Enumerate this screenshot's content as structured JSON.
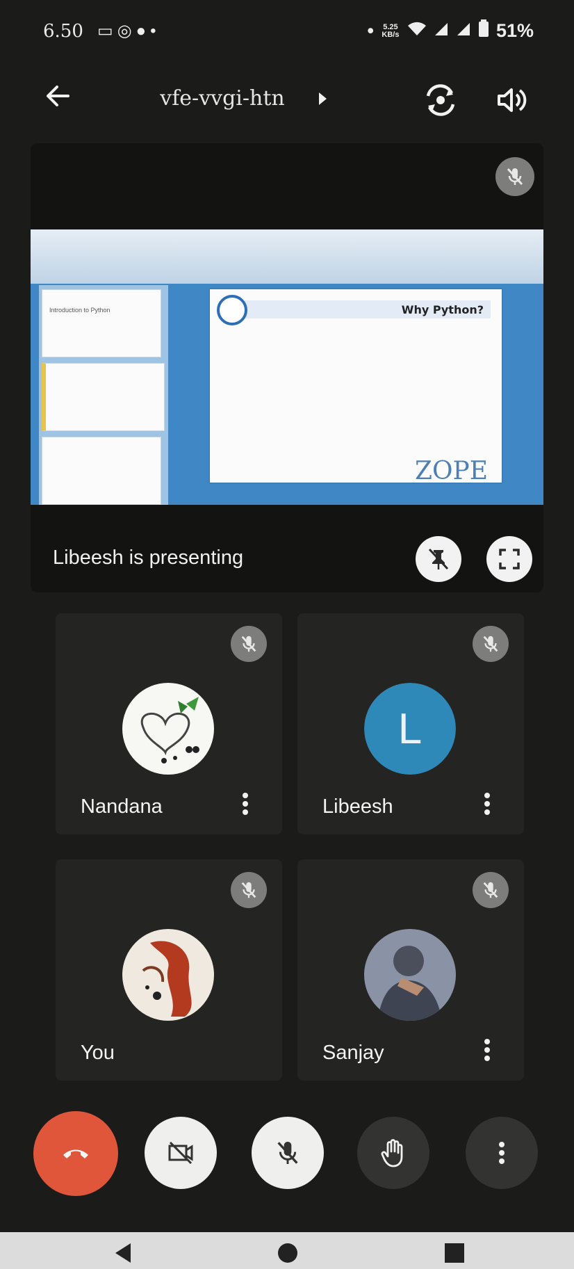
{
  "status_bar": {
    "time": "6.50",
    "left_icons": [
      "camera-notification-icon",
      "whatsapp-icon",
      "chat-icon",
      "dot-icon"
    ],
    "net_speed": "5.25 KB/s",
    "right_icons": [
      "dot-icon",
      "wifi-icon",
      "signal-icon",
      "signal-icon",
      "battery-icon"
    ],
    "battery": "51%"
  },
  "top_bar": {
    "meeting_code": "vfe-vvgi-htn",
    "icons": [
      "back-arrow-icon",
      "chevron-right-icon",
      "switch-camera-icon",
      "speaker-icon"
    ]
  },
  "presentation": {
    "label": "Libeesh is presenting",
    "slide_title": "Why Python?",
    "slide_brand": "ZOPE",
    "thumb_text": "Introduction to Python"
  },
  "participants": [
    {
      "name": "Nandana",
      "avatar": "photo",
      "muted": true
    },
    {
      "name": "Libeesh",
      "avatar_letter": "L",
      "avatar_color": "#2f89b8",
      "muted": true
    },
    {
      "name": "You",
      "avatar": "photo",
      "muted": true
    },
    {
      "name": "Sanjay",
      "avatar": "photo",
      "muted": true
    }
  ],
  "controls": [
    "end-call",
    "camera-off",
    "mic-off",
    "raise-hand",
    "more-options"
  ],
  "colors": {
    "background": "#1b1b19",
    "tile": "#242422",
    "end_call": "#e0563a",
    "mute_badge": "#7d7d7b",
    "avatar_l": "#2f89b8"
  }
}
